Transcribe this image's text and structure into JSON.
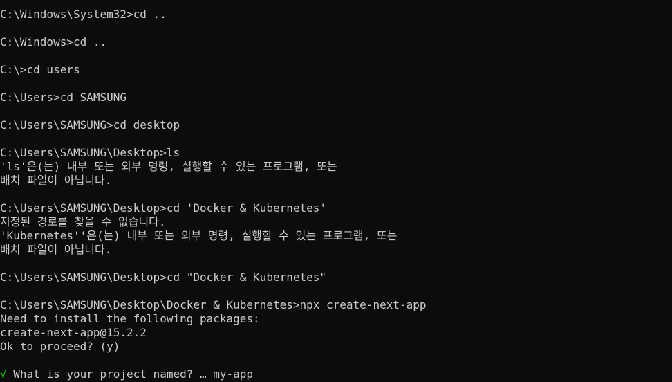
{
  "console": {
    "lines": {
      "l01": "C:\\Windows\\System32>cd ..",
      "l02": "C:\\Windows>cd ..",
      "l03": "C:\\>cd users",
      "l04": "C:\\Users>cd SAMSUNG",
      "l05": "C:\\Users\\SAMSUNG>cd desktop",
      "l06": "C:\\Users\\SAMSUNG\\Desktop>ls",
      "l07": "'ls'은(는) 내부 또는 외부 명령, 실행할 수 있는 프로그램, 또는",
      "l08": "배치 파일이 아닙니다.",
      "l09": "C:\\Users\\SAMSUNG\\Desktop>cd 'Docker & Kubernetes'",
      "l10": "지정된 경로를 찾을 수 없습니다.",
      "l11": "'Kubernetes''은(는) 내부 또는 외부 명령, 실행할 수 있는 프로그램, 또는",
      "l12": "배치 파일이 아닙니다.",
      "l13": "C:\\Users\\SAMSUNG\\Desktop>cd \"Docker & Kubernetes\"",
      "l14": "C:\\Users\\SAMSUNG\\Desktop\\Docker & Kubernetes>npx create-next-app",
      "l15": "Need to install the following packages:",
      "l16": "create-next-app@15.2.2",
      "l17": "Ok to proceed? (y)"
    },
    "prompt": {
      "check_mark": "√",
      "question": " What is your project named? … ",
      "answer": "my-app"
    }
  },
  "colors": {
    "background": "#0c0c0c",
    "text": "#cccccc",
    "check": "#16c60c"
  }
}
